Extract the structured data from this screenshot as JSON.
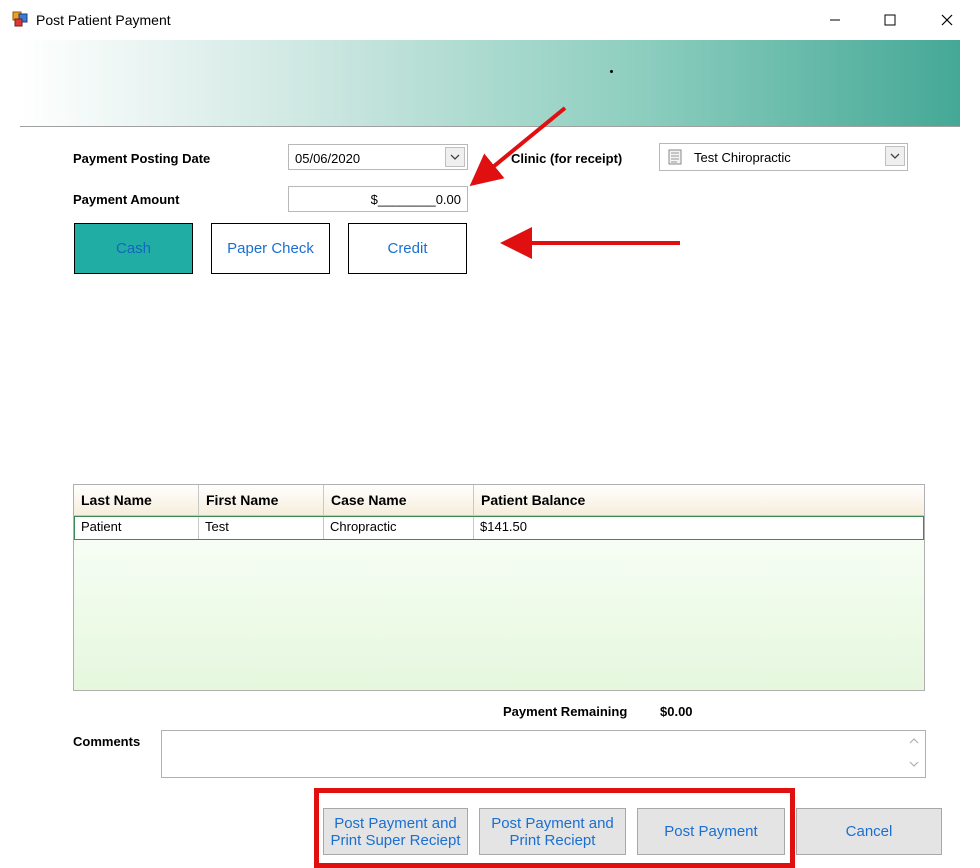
{
  "window": {
    "title": "Post Patient Payment",
    "controls": {
      "minimize": "minimize",
      "maximize": "maximize",
      "close": "close"
    }
  },
  "form": {
    "posting_date_label": "Payment Posting Date",
    "posting_date_value": "05/06/2020",
    "amount_label": "Payment Amount",
    "amount_value": "$________0.00",
    "clinic_label": "Clinic (for receipt)",
    "clinic_value": "Test Chiropractic"
  },
  "payment_methods": {
    "cash": "Cash",
    "paper_check": "Paper Check",
    "credit": "Credit",
    "selected": "cash"
  },
  "grid": {
    "columns": [
      "Last Name",
      "First Name",
      "Case Name",
      "Patient Balance"
    ],
    "rows": [
      [
        "Patient",
        "Test",
        "Chropractic",
        "$141.50"
      ]
    ]
  },
  "summary": {
    "remaining_label": "Payment Remaining",
    "remaining_value": "$0.00"
  },
  "comments": {
    "label": "Comments",
    "value": ""
  },
  "buttons": {
    "post_super": "Post Payment and\nPrint Super Reciept",
    "post_print": "Post Payment and\nPrint Reciept",
    "post": "Post Payment",
    "cancel": "Cancel"
  },
  "colors": {
    "cash_selected": "#20aea4",
    "link_text": "#1a6fd1",
    "annotation": "#e01010",
    "banner_end": "#45a896"
  },
  "icons": {
    "app": "app-window-icon",
    "dropdown": "chevron-down-icon",
    "clinic": "document-icon"
  }
}
